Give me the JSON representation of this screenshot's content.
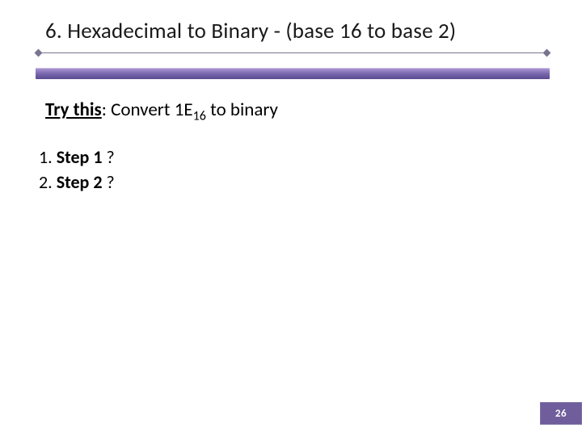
{
  "title": "6. Hexadecimal to Binary - (base 16 to base 2)",
  "prompt": {
    "lead": "Try this",
    "colon": ":",
    "rest_before": "  Convert 1E",
    "subscript": "16",
    "rest_after": " to binary"
  },
  "steps": [
    {
      "num": "1.",
      "name": "Step 1",
      "tail": " ?"
    },
    {
      "num": "2.",
      "name": "Step 2",
      "tail": " ?"
    }
  ],
  "page_number": "26"
}
